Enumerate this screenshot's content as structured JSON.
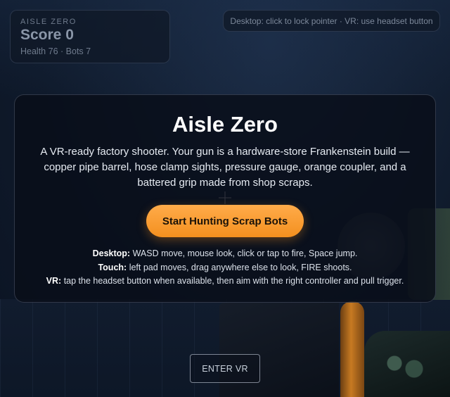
{
  "hud": {
    "brand": "AISLE ZERO",
    "score_label": "Score",
    "score": "0",
    "health_label": "Health",
    "health": "76",
    "bots_label": "Bots",
    "bots": "7"
  },
  "hint": "Desktop: click to lock pointer · VR: use headset button",
  "overlay": {
    "title": "Aisle Zero",
    "description": "A VR-ready factory shooter. Your gun is a hardware-store Frankenstein build — copper pipe barrel, hose clamp sights, pressure gauge, orange coupler, and a battered grip made from shop scraps.",
    "start_label": "Start Hunting Scrap Bots",
    "controls": [
      {
        "label": "Desktop:",
        "text": "WASD move, mouse look, click or tap to fire, Space jump."
      },
      {
        "label": "Touch:",
        "text": "left pad moves, drag anywhere else to look, FIRE shoots."
      },
      {
        "label": "VR:",
        "text": "tap the headset button when available, then aim with the right controller and pull trigger."
      }
    ]
  },
  "vr_button": "ENTER VR",
  "colors": {
    "accent": "#f4901f",
    "background": "#0f1a2b",
    "panel": "#080e18"
  }
}
